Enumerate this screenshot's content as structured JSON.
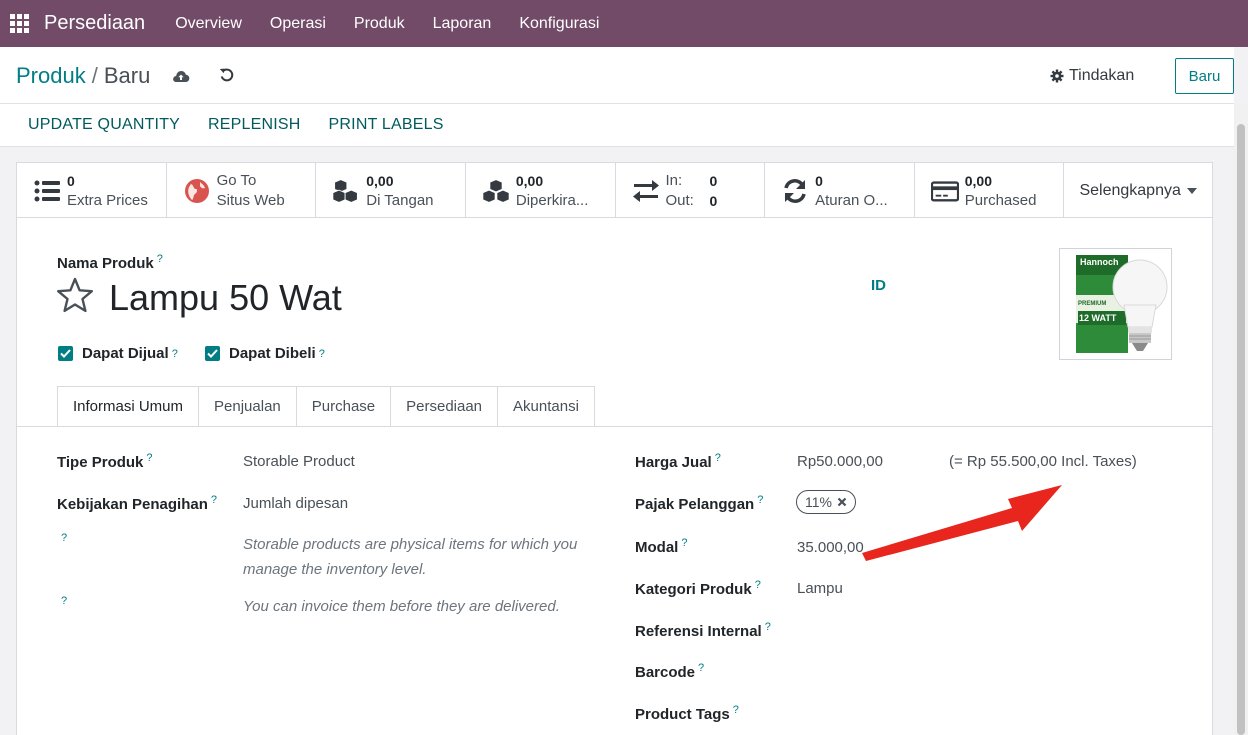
{
  "navbar": {
    "brand": "Persediaan",
    "menu": [
      "Overview",
      "Operasi",
      "Produk",
      "Laporan",
      "Konfigurasi"
    ],
    "bg_color": "#714b67"
  },
  "control": {
    "breadcrumb_parent": "Produk",
    "breadcrumb_sep": "/",
    "breadcrumb_current": "Baru",
    "save_icon": "cloud-upload-icon",
    "discard_icon": "undo-icon",
    "actions_label": "Tindakan",
    "new_button": "Baru"
  },
  "action_buttons": [
    "UPDATE QUANTITY",
    "REPLENISH",
    "PRINT LABELS"
  ],
  "stat_buttons": [
    {
      "icon": "list-icon",
      "value": "0",
      "label": "Extra Prices"
    },
    {
      "icon": "globe-icon",
      "value": "Go To",
      "label": "Situs Web"
    },
    {
      "icon": "cubes-icon",
      "value": "0,00",
      "label": "Di Tangan"
    },
    {
      "icon": "cubes-icon",
      "value": "0,00",
      "label": "Diperkira..."
    },
    {
      "icon": "exchange-icon",
      "in_label": "In:",
      "in_value": "0",
      "out_label": "Out:",
      "out_value": "0"
    },
    {
      "icon": "refresh-icon",
      "value": "0",
      "label": "Aturan O..."
    },
    {
      "icon": "credit-card-icon",
      "value": "0,00",
      "label": "Purchased"
    }
  ],
  "more_label": "Selengkapnya",
  "form": {
    "name_label": "Nama Produk",
    "name_value": "Lampu 50 Wat",
    "lang": "ID",
    "can_sell_label": "Dapat Dijual",
    "can_buy_label": "Dapat Dibeli",
    "help_mark": "?"
  },
  "tabs": [
    "Informasi Umum",
    "Penjualan",
    "Purchase",
    "Persediaan",
    "Akuntansi"
  ],
  "left_fields": {
    "type_label": "Tipe Produk",
    "type_value": "Storable Product",
    "invoice_label": "Kebijakan Penagihan",
    "invoice_value": "Jumlah dipesan",
    "hint1": "Storable products are physical items for which you manage the inventory level.",
    "hint2": "You can invoice them before they are delivered."
  },
  "right_fields": {
    "price_label": "Harga Jual",
    "price_value": "Rp50.000,00",
    "price_incl": "(= Rp 55.500,00 Incl. Taxes)",
    "tax_label": "Pajak Pelanggan",
    "tax_value": "11%",
    "cost_label": "Modal",
    "cost_value": "35.000,00",
    "categ_label": "Kategori Produk",
    "categ_value": "Lampu",
    "ref_label": "Referensi Internal",
    "barcode_label": "Barcode",
    "tags_label": "Product Tags"
  },
  "product_image": {
    "box_text": "Hannoch",
    "watt_text": "12 WATT",
    "premium_text": "PREMIUM"
  },
  "accent_color": "#017e84"
}
